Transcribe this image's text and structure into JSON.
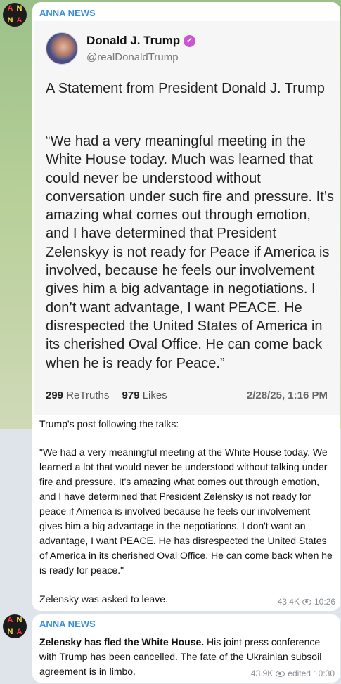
{
  "channel": {
    "name": "ANNA NEWS",
    "avatar_letters": [
      "A",
      "N",
      "N",
      "A"
    ]
  },
  "message1": {
    "post": {
      "author": "Donald J. Trump",
      "handle": "@realDonaldTrump",
      "title": "A Statement from President Donald J. Trump",
      "body": "“We had a very meaningful meeting in the White House today. Much was learned that could never be understood without conversation under such fire and pressure. It’s amazing what comes out through emotion, and I have determined that President Zelenskyy is not ready for Peace if America is involved, because he feels our involvement gives him a big advantage in negotiations. I don’t want advantage, I want PEACE. He disrespected the United States of America in its cherished Oval Office. He can come back when he is ready for Peace.”",
      "retruths_count": "299",
      "retruths_label": "ReTruths",
      "likes_count": "979",
      "likes_label": "Likes",
      "date": "2/28/25, 1:16 PM"
    },
    "caption_intro": "Trump's post following the talks:",
    "caption_quote": "\"We had a very meaningful meeting at the White House today. We learned a lot that would never be understood without talking under fire and pressure. It's amazing what comes out through emotion, and I have determined that President Zelensky is not ready for peace if America is involved because he feels our involvement gives him a big advantage in the negotiations. I don't want an advantage, I want PEACE. He has disrespected the United States of America in its cherished Oval Office. He can come back when he is ready for peace.\"",
    "caption_outro": "Zelensky was asked to leave.",
    "views": "43.4K",
    "time": "10:26"
  },
  "message2": {
    "bold_text": "Zelensky has fled the White House.",
    "text": " His joint press conference with Trump has been cancelled. The fate of the Ukrainian subsoil agreement is in limbo.",
    "views": "43.9K",
    "edited": "edited",
    "time": "10:30"
  },
  "colors": {
    "channel_name": "#3a8fd6",
    "verified_badge": "#c957cf",
    "bg_top": "#b7cf98"
  }
}
